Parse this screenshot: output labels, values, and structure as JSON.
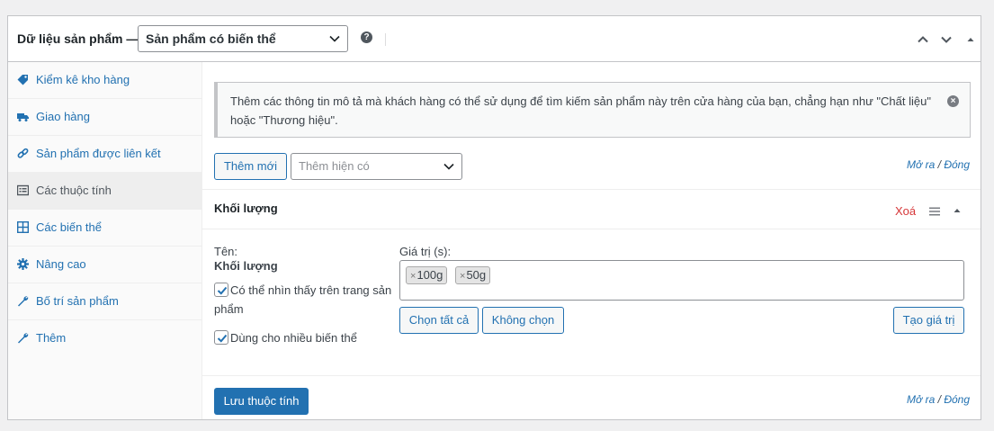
{
  "header": {
    "title": "Dữ liệu sản phẩm —",
    "product_type": "Sản phẩm có biến thể",
    "help_icon": "help-icon",
    "move_up_icon": "chevron-up-icon",
    "move_down_icon": "chevron-down-icon",
    "toggle_icon": "triangle-up-icon"
  },
  "sidebar": {
    "items": [
      {
        "label": "Kiểm kê kho hàng",
        "icon": "tag-icon"
      },
      {
        "label": "Giao hàng",
        "icon": "truck-icon"
      },
      {
        "label": "Sản phẩm được liên kết",
        "icon": "link-icon"
      },
      {
        "label": "Các thuộc tính",
        "icon": "list-icon",
        "active": true
      },
      {
        "label": "Các biến thể",
        "icon": "grid-icon"
      },
      {
        "label": "Nâng cao",
        "icon": "gear-icon"
      },
      {
        "label": "Bố trí sản phẩm",
        "icon": "wrench-icon"
      },
      {
        "label": "Thêm",
        "icon": "wrench-icon"
      }
    ]
  },
  "notice": {
    "text": "Thêm các thông tin mô tả mà khách hàng có thể sử dụng để tìm kiếm sản phẩm này trên cửa hàng của bạn, chẳng hạn như \"Chất liệu\" hoặc \"Thương hiệu\"."
  },
  "toolbar": {
    "add_new_label": "Thêm mới",
    "add_existing_placeholder": "Thêm hiện có",
    "expand_label": "Mở ra",
    "separator": " / ",
    "close_label": "Đóng"
  },
  "attribute": {
    "title": "Khối lượng",
    "remove_label": "Xoá",
    "name_label": "Tên:",
    "name_value": "Khối lượng",
    "visible_label": "Có thể nhìn thấy trên trang sản phẩm",
    "visible_checked": true,
    "variation_label": "Dùng cho nhiều biến thể",
    "variation_checked": true,
    "values_label": "Giá trị (s):",
    "values": [
      "100g",
      "50g"
    ],
    "select_all_label": "Chọn tất cả",
    "select_none_label": "Không chọn",
    "create_value_label": "Tạo giá trị"
  },
  "footer": {
    "save_label": "Lưu thuộc tính"
  },
  "colors": {
    "accent": "#2271b1",
    "danger": "#d63638"
  }
}
